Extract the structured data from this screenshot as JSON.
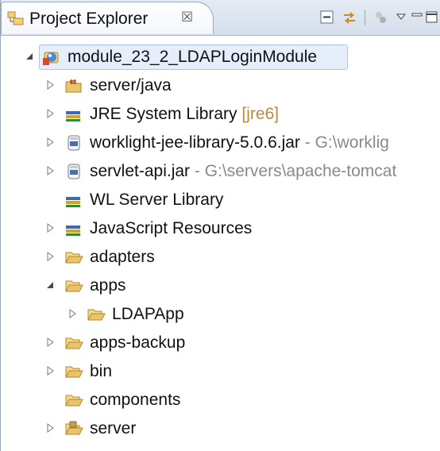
{
  "view": {
    "tab_title": "Project Explorer",
    "tab_close_glyph": "☒"
  },
  "toolbar": {
    "collapse_all": "collapse-all-icon",
    "link_with_editor": "link-with-editor-icon",
    "filters": "filters-icon",
    "view_menu": "view-menu-icon",
    "minimize": "minimize-icon",
    "maximize": "maximize-icon"
  },
  "tree": {
    "root": {
      "label": "module_23_2_LDAPLoginModule",
      "expanded": true,
      "selected": true
    },
    "items": [
      {
        "label": "server/java",
        "decoration": "",
        "icon": "source-folder-icon",
        "expanded": false
      },
      {
        "label": "JRE System Library",
        "decoration": "[jre6]",
        "icon": "library-icon",
        "expanded": false
      },
      {
        "label": "worklight-jee-library-5.0.6.jar",
        "decoration": "- G:\\worklig",
        "icon": "jar-icon",
        "expanded": false
      },
      {
        "label": "servlet-api.jar",
        "decoration": "- G:\\servers\\apache-tomcat",
        "icon": "jar-icon",
        "expanded": false
      },
      {
        "label": "WL Server Library",
        "decoration": "",
        "icon": "library-icon",
        "expanded": null
      },
      {
        "label": "JavaScript Resources",
        "decoration": "",
        "icon": "library-icon",
        "expanded": false
      },
      {
        "label": "adapters",
        "decoration": "",
        "icon": "folder-icon",
        "expanded": false
      },
      {
        "label": "apps",
        "decoration": "",
        "icon": "folder-icon",
        "expanded": true
      },
      {
        "label": "LDAPApp",
        "decoration": "",
        "icon": "folder-icon",
        "expanded": false
      },
      {
        "label": "apps-backup",
        "decoration": "",
        "icon": "folder-icon",
        "expanded": false
      },
      {
        "label": "bin",
        "decoration": "",
        "icon": "folder-icon",
        "expanded": false
      },
      {
        "label": "components",
        "decoration": "",
        "icon": "folder-icon",
        "expanded": null
      },
      {
        "label": "server",
        "decoration": "",
        "icon": "package-folder-icon",
        "expanded": false
      }
    ]
  },
  "colors": {
    "folder": "#e9c46a",
    "folder_outline": "#b4882a",
    "library": "#3d6bb3",
    "selection_border": "#7a99c6"
  }
}
